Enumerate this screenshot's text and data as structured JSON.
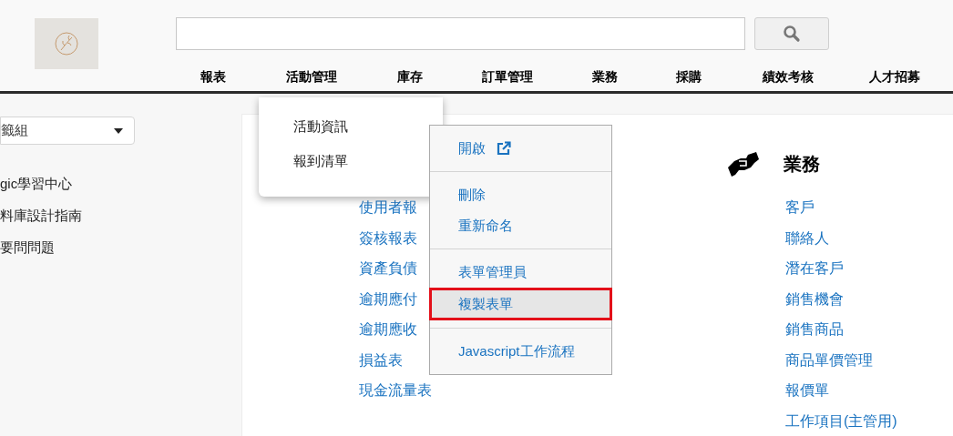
{
  "header": {
    "nav": [
      {
        "label": "報表"
      },
      {
        "label": "活動管理"
      },
      {
        "label": "庫存"
      },
      {
        "label": "訂單管理"
      },
      {
        "label": "業務"
      },
      {
        "label": "採購"
      },
      {
        "label": "績效考核"
      },
      {
        "label": "人才招募"
      }
    ]
  },
  "nav_dropdown": {
    "items": [
      "活動資訊",
      "報到清單"
    ]
  },
  "sidebar": {
    "select": {
      "value": "籤組"
    },
    "links": [
      "gic學習中心",
      "料庫設計指南",
      "要問問題"
    ]
  },
  "reports": {
    "links": [
      "使用者報",
      "簽核報表",
      "資產負債",
      "逾期應付",
      "逾期應收",
      "損益表",
      "現金流量表"
    ]
  },
  "business": {
    "title": "業務",
    "links": [
      "客戶",
      "聯絡人",
      "潛在客戶",
      "銷售機會",
      "銷售商品",
      "商品單價管理",
      "報價單",
      "工作項目(主管用)"
    ]
  },
  "context_menu": {
    "groups": [
      [
        {
          "label": "開啟",
          "kind": "external",
          "highlighted": false
        }
      ],
      [
        {
          "label": "刪除",
          "kind": "plain",
          "highlighted": false
        },
        {
          "label": "重新命名",
          "kind": "plain",
          "highlighted": false
        }
      ],
      [
        {
          "label": "表單管理員",
          "kind": "plain",
          "highlighted": false
        },
        {
          "label": "複製表單",
          "kind": "plain",
          "highlighted": true
        }
      ],
      [
        {
          "label": "Javascript工作流程",
          "kind": "plain",
          "highlighted": false
        }
      ]
    ]
  }
}
